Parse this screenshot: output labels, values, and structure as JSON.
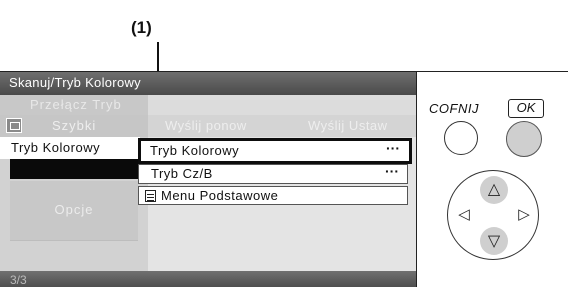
{
  "callout": {
    "label": "(1)"
  },
  "screen": {
    "title": "Skanuj/Tryb Kolorowy",
    "menu_tab": "Przełącz Tryb",
    "tabs": {
      "szybki": "Szybki",
      "resend": "Wyślij ponow",
      "send_settings": "Wyślij Ustaw"
    },
    "left_menu": {
      "color_mode": "Tryb Kolorowy",
      "options": "Opcje"
    },
    "list": [
      {
        "label": "Tryb Kolorowy",
        "more": "···"
      },
      {
        "label": "Tryb Cz/B",
        "more": "···"
      },
      {
        "label": "Menu Podstawowe"
      }
    ],
    "page": "3/3"
  },
  "panel": {
    "back_label": "COFNIJ",
    "ok_label": "OK",
    "arrows": {
      "up": "△",
      "down": "▽",
      "left": "◁",
      "right": "▷"
    }
  },
  "icons": [
    "scan-mode-icon",
    "menu-list-icon",
    "up-arrow-icon",
    "down-arrow-icon",
    "left-arrow-icon",
    "right-arrow-icon"
  ]
}
